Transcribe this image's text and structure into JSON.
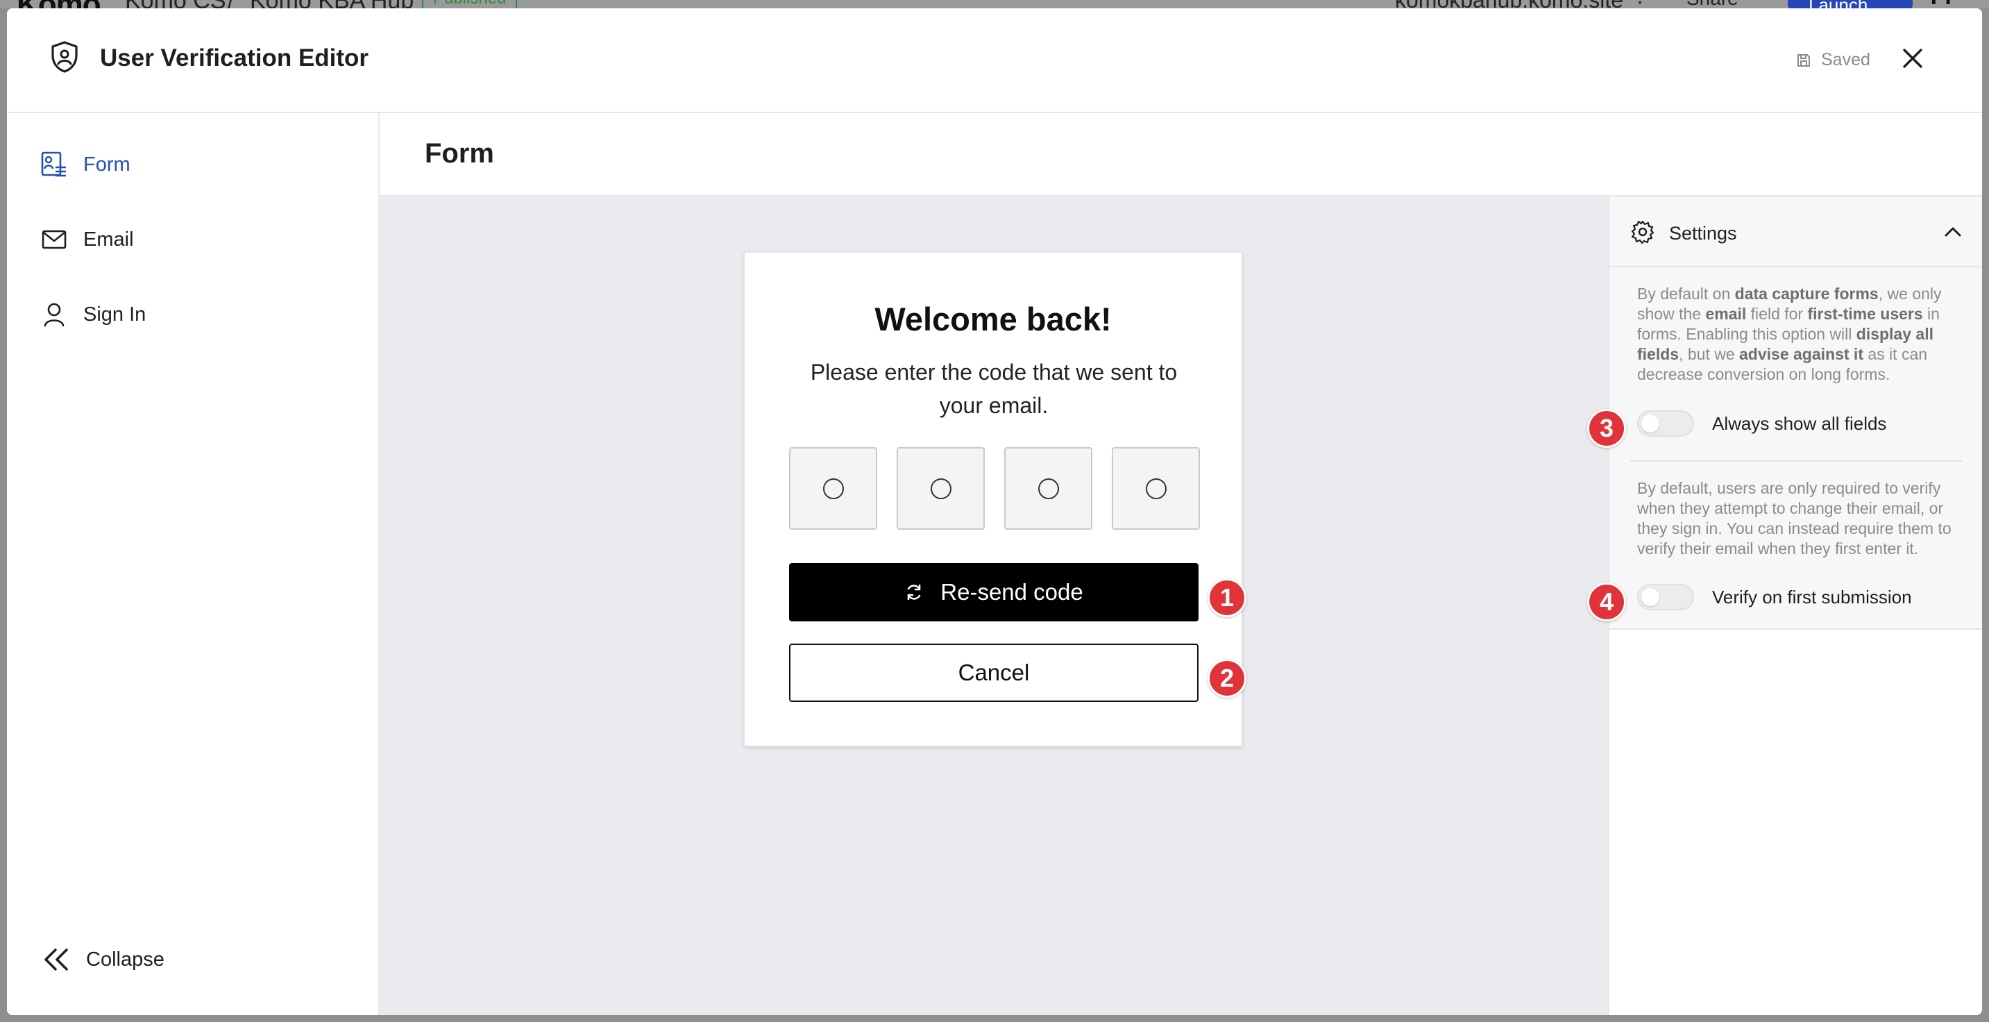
{
  "background": {
    "logo": "Komo",
    "crumb_1": "Komo CS",
    "crumb_sep": "/",
    "crumb_2": "Komo KBA Hub",
    "published": "Published",
    "site": "komokbahub.komo.site",
    "share": "Share",
    "launch": "Launch",
    "avatar": "TT"
  },
  "header": {
    "title": "User Verification Editor",
    "saved_label": "Saved",
    "icon": "shield-icon"
  },
  "nav": {
    "items": [
      {
        "label": "Form",
        "icon": "form-icon",
        "active": true
      },
      {
        "label": "Email",
        "icon": "mail-icon",
        "active": false
      },
      {
        "label": "Sign In",
        "icon": "user-icon",
        "active": false
      }
    ],
    "collapse_label": "Collapse"
  },
  "main": {
    "heading": "Form"
  },
  "card": {
    "title": "Welcome back!",
    "subtitle": "Please enter the code that we sent to your email.",
    "code_fields": 4,
    "resend_label": "Re-send code",
    "cancel_label": "Cancel"
  },
  "badges": [
    "1",
    "2",
    "3",
    "4"
  ],
  "settings": {
    "title": "Settings",
    "option_1": {
      "description_parts": [
        "By default on ",
        "data capture forms",
        ", we only show the ",
        "email",
        " field for ",
        "first-time users",
        " in forms. Enabling this option will ",
        "display all fields",
        ", but we ",
        "advise against it",
        " as it can decrease conversion on long forms."
      ],
      "toggle_label": "Always show all fields",
      "enabled": false
    },
    "option_2": {
      "description": "By default, users are only required to verify when they attempt to change their email, or they sign in. You can instead require them to verify their email when they first enter it.",
      "toggle_label": "Verify on first submission",
      "enabled": false
    }
  },
  "colors": {
    "accent": "#2450b0",
    "badge": "#e0343a",
    "primary_button": "#000000",
    "canvas": "#ebebef"
  }
}
